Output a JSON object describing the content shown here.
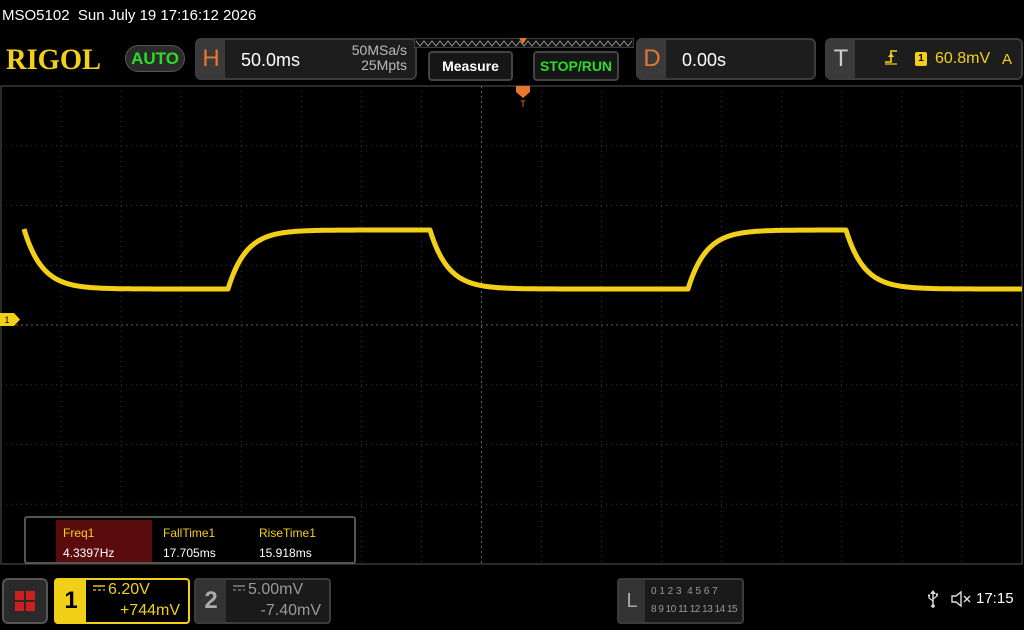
{
  "title_bar": {
    "text": "MSO5102  Sun July 19 17:16:12 2026"
  },
  "top_bar": {
    "logo": "RIGOL",
    "auto_label": "AUTO",
    "horizontal": {
      "letter": "H",
      "timebase": "50.0ms",
      "sample_rate": "50MSa/s",
      "memory_depth": "25Mpts"
    },
    "measure_label": "Measure",
    "stop_run_label": "STOP/RUN",
    "delay": {
      "letter": "D",
      "value": "0.00s"
    },
    "trigger": {
      "letter": "T",
      "source": "1",
      "level": "60.8mV",
      "mode": "A"
    }
  },
  "screen": {
    "trigger_marker_label": "T",
    "ch1_ground_marker": "1",
    "trace_color": "#f3d018"
  },
  "measurements": [
    {
      "name": "Freq1",
      "value": "4.3397Hz"
    },
    {
      "name": "FallTime1",
      "value": "17.705ms"
    },
    {
      "name": "RiseTime1",
      "value": "15.918ms"
    }
  ],
  "bottom_bar": {
    "ch1": {
      "number": "1",
      "coupling_icon": "dc-coupling-icon",
      "scale": "6.20V",
      "offset": "+744mV"
    },
    "ch2": {
      "number": "2",
      "coupling_icon": "dc-coupling-icon",
      "scale": "5.00mV",
      "offset": "-7.40mV"
    },
    "la": {
      "letter": "L",
      "row1": "0 1 2 3  4 5 6 7",
      "row2": "8 9 10 11 12 13 14 15"
    },
    "usb_icon": "usb-icon",
    "speaker_icon": "speaker-muted-icon",
    "clock": "17:15"
  }
}
